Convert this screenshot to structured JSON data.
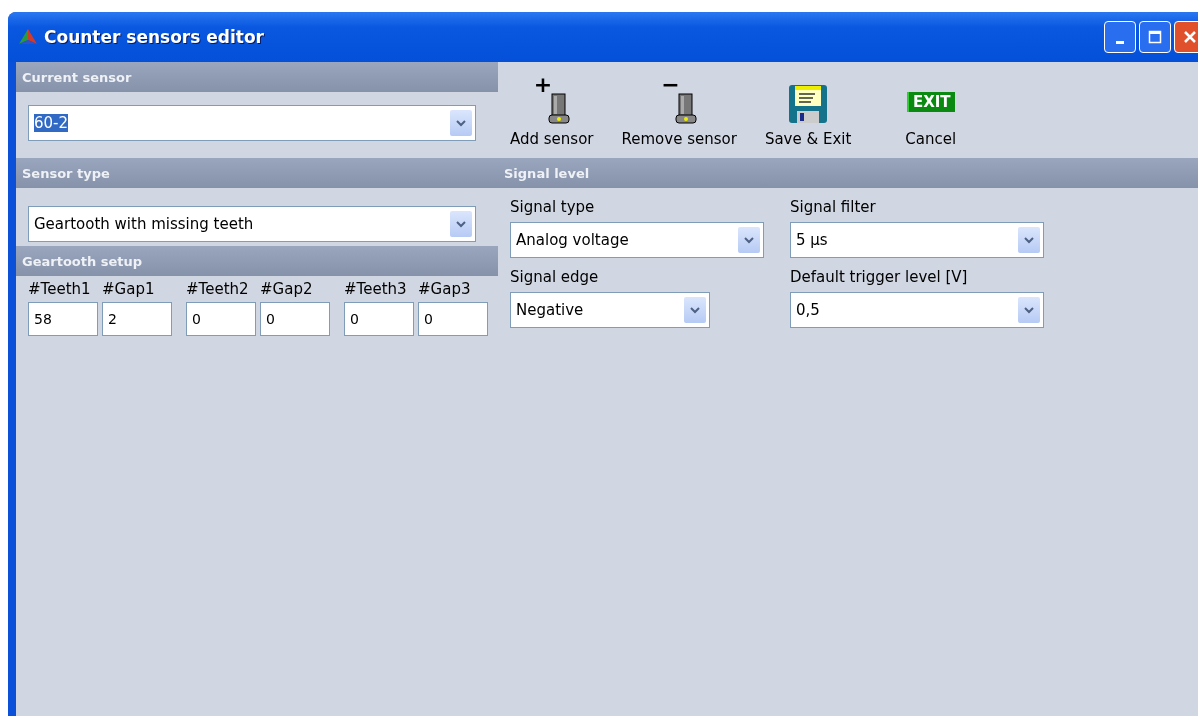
{
  "window": {
    "title": "Counter sensors editor"
  },
  "current_sensor": {
    "heading": "Current sensor",
    "value": "60-2",
    "text_selected": true
  },
  "toolbar": [
    {
      "kind": "add",
      "label": "Add sensor",
      "icon_text": "+"
    },
    {
      "kind": "remove",
      "label": "Remove sensor",
      "icon_text": "−"
    },
    {
      "kind": "save",
      "label": "Save & Exit"
    },
    {
      "kind": "exit",
      "label": "Cancel",
      "icon_text": "EXIT"
    }
  ],
  "sensor_type": {
    "heading": "Sensor type",
    "value": "Geartooth with missing teeth"
  },
  "geartooth_setup": {
    "heading": "Geartooth setup",
    "fields": [
      {
        "label": "#Teeth1",
        "value": "58"
      },
      {
        "label": "#Gap1",
        "value": "2"
      },
      {
        "label": "#Teeth2",
        "value": "0"
      },
      {
        "label": "#Gap2",
        "value": "0"
      },
      {
        "label": "#Teeth3",
        "value": "0"
      },
      {
        "label": "#Gap3",
        "value": "0"
      }
    ]
  },
  "signal_level": {
    "heading": "Signal level",
    "fields": [
      {
        "label": "Signal type",
        "value": "Analog voltage"
      },
      {
        "label": "Signal filter",
        "value": "5 µs"
      },
      {
        "label": "Signal edge",
        "value": "Negative"
      },
      {
        "label": "Default trigger level [V]",
        "value": "0,5"
      }
    ]
  }
}
